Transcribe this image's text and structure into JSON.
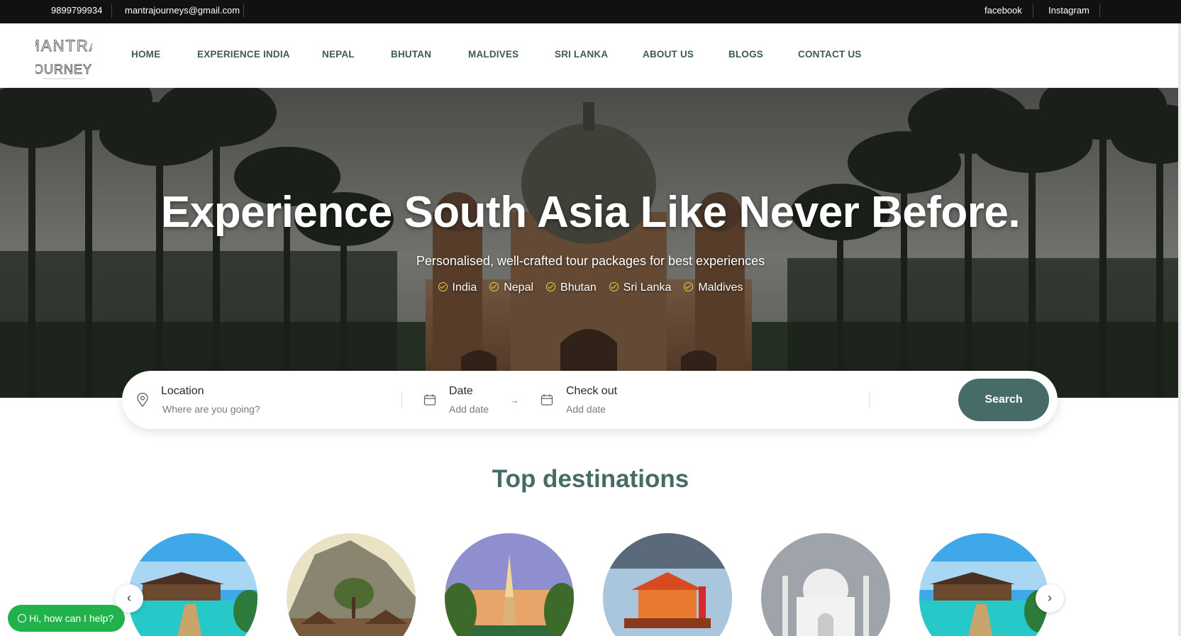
{
  "topbar": {
    "phone": "9899799934",
    "email": "mantrajourneys@gmail.com",
    "facebook": "facebook",
    "instagram": "Instagram"
  },
  "logo": {
    "line1": "MANTRA",
    "line2": "JOURNEYS"
  },
  "nav": {
    "items": [
      "HOME",
      "EXPERIENCE INDIA",
      "NEPAL",
      "BHUTAN",
      "MALDIVES",
      "SRI LANKA",
      "ABOUT US",
      "BLOGS",
      "CONTACT US"
    ]
  },
  "hero": {
    "title": "Experience South Asia Like Never Before.",
    "subtitle": "Personalised, well-crafted tour packages for best experiences",
    "destinations": [
      "India",
      "Nepal",
      "Bhutan",
      "Sri Lanka",
      "Maldives"
    ]
  },
  "search": {
    "location_label": "Location",
    "location_placeholder": "Where are you going?",
    "date_label": "Date",
    "date_placeholder": "Add date",
    "checkout_label": "Check out",
    "checkout_placeholder": "Add date",
    "button": "Search"
  },
  "top_destinations": {
    "title": "Top destinations"
  },
  "help": {
    "label": "Hi, how can I help?"
  },
  "colors": {
    "brand": "#476b67",
    "nav_text": "#3e5a55",
    "topbar_bg": "#111111",
    "help_green": "#22b24c",
    "check_yellow": "#f0d040"
  },
  "icons": [
    "map-pin-icon",
    "calendar-icon",
    "arrow-right-icon",
    "calendar-out-icon",
    "chevron-left-icon",
    "chevron-right-icon",
    "whatsapp-icon",
    "check-circle-icon"
  ]
}
